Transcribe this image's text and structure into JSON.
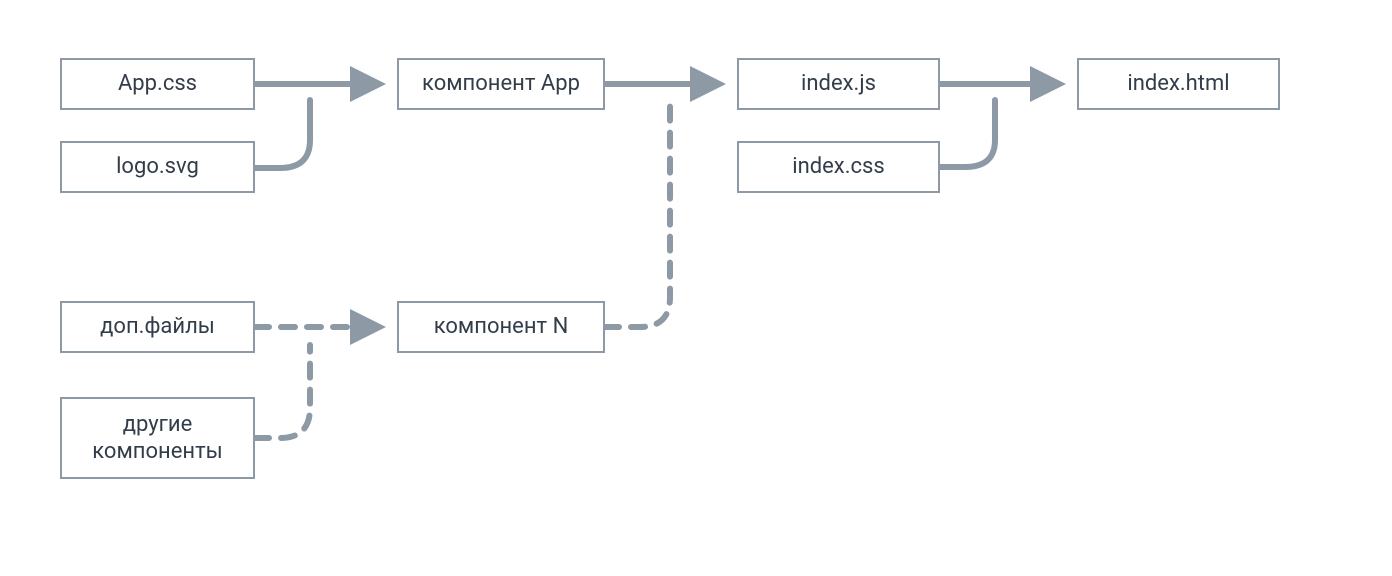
{
  "nodes": {
    "app_css": "App.css",
    "logo_svg": "logo.svg",
    "component_app": "компонент App",
    "index_js": "index.js",
    "index_css": "index.css",
    "index_html": "index.html",
    "extra_files": "доп.файлы",
    "other_components": "другие\nкомпоненты",
    "component_n": "компонент N"
  }
}
